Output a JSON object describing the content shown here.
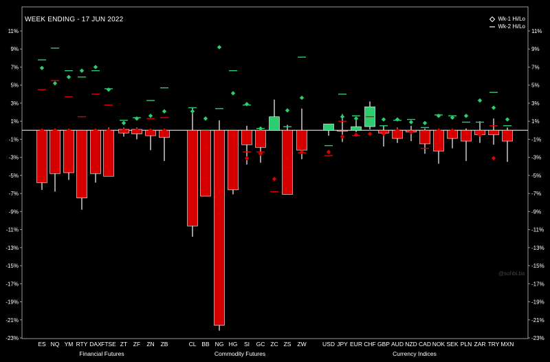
{
  "chart_data": {
    "type": "bar",
    "title": "WEEK ENDING - 17 JUN 2022",
    "ylim": [
      -23,
      11
    ],
    "yticks": [
      11,
      9,
      7,
      5,
      3,
      1,
      -1,
      -3,
      -5,
      -7,
      -9,
      -11,
      -13,
      -15,
      -17,
      -19,
      -21,
      -23
    ],
    "ytick_labels": [
      "11%",
      "9%",
      "7%",
      "5%",
      "3%",
      "1%",
      "-1%",
      "-3%",
      "-5%",
      "-7%",
      "-9%",
      "-11%",
      "-13%",
      "-15%",
      "-17%",
      "-19%",
      "-21%",
      "-23%"
    ],
    "grid": false,
    "legend_position": "top-right",
    "legend": [
      {
        "label": "Wk-1 Hi/Lo",
        "marker": "diamond"
      },
      {
        "label": "Wk-2 Hi/Lo",
        "marker": "dash"
      }
    ],
    "colors": {
      "down": "#d40000",
      "up": "#2ecc71",
      "wick": "#ffffff",
      "wk1_high": "#2ecc71",
      "wk1_low": "#e00000",
      "wk2_high": "#2ecc71",
      "wk2_low": "#e00000",
      "zero_line": "#ffffff"
    },
    "groups": [
      {
        "name": "Financial Futures",
        "categories": [
          "ES",
          "NQ",
          "YM",
          "RTY",
          "DAX",
          "FTSE",
          "ZT",
          "ZF",
          "ZN",
          "ZB"
        ]
      },
      {
        "name": "Commodity Futures",
        "categories": [
          "CL",
          "BB",
          "NG",
          "HG",
          "SI",
          "GC",
          "ZC",
          "ZS",
          "ZW"
        ]
      },
      {
        "name": "Currency Indices",
        "categories": [
          "USD",
          "JPY",
          "EUR",
          "CHF",
          "GBP",
          "AUD",
          "NZD",
          "CAD",
          "NOK",
          "SEK",
          "PLN",
          "ZAR",
          "TRY",
          "MXN"
        ]
      }
    ],
    "series": [
      {
        "name": "ES",
        "open": 0,
        "close": -5.8,
        "high": 0,
        "low": -6.6,
        "wk1_hi": 6.9,
        "wk1_lo": 0,
        "wk2_hi": 7.8,
        "wk2_lo": 4.5
      },
      {
        "name": "NQ",
        "open": 0,
        "close": -4.8,
        "high": 0,
        "low": -6.8,
        "wk1_hi": 5.2,
        "wk1_lo": 0,
        "wk2_hi": 9.1,
        "wk2_lo": 5.5
      },
      {
        "name": "YM",
        "open": 0,
        "close": -4.7,
        "high": 0,
        "low": -5.5,
        "wk1_hi": 5.9,
        "wk1_lo": 0,
        "wk2_hi": 6.6,
        "wk2_lo": 3.7
      },
      {
        "name": "RTY",
        "open": 0,
        "close": -7.5,
        "high": 0,
        "low": -8.8,
        "wk1_hi": 6.6,
        "wk1_lo": -0.5,
        "wk2_hi": 5.9,
        "wk2_lo": 1.5
      },
      {
        "name": "DAX",
        "open": 0,
        "close": -4.8,
        "high": 0,
        "low": -5.8,
        "wk1_hi": 7.0,
        "wk1_lo": 0,
        "wk2_hi": 6.6,
        "wk2_lo": 4.0
      },
      {
        "name": "FTSE",
        "open": 0,
        "close": -5.1,
        "high": 0.3,
        "low": -5.1,
        "wk1_hi": 4.5,
        "wk1_lo": 0,
        "wk2_hi": 4.6,
        "wk2_lo": 2.8
      },
      {
        "name": "ZT",
        "open": 0.1,
        "close": -0.3,
        "high": 0.3,
        "low": -0.7,
        "wk1_hi": 0.8,
        "wk1_lo": 0,
        "wk2_hi": 1.1,
        "wk2_lo": 0
      },
      {
        "name": "ZF",
        "open": 0.1,
        "close": -0.4,
        "high": 0.3,
        "low": -1.0,
        "wk1_hi": 1.3,
        "wk1_lo": 0,
        "wk2_hi": 1.4,
        "wk2_lo": 0
      },
      {
        "name": "ZN",
        "open": 0,
        "close": -0.6,
        "high": 0,
        "low": -2.2,
        "wk1_hi": 1.6,
        "wk1_lo": 0,
        "wk2_hi": 3.3,
        "wk2_lo": 1.3
      },
      {
        "name": "ZB",
        "open": 0,
        "close": -0.8,
        "high": 0,
        "low": -3.4,
        "wk1_hi": 2.1,
        "wk1_lo": 0,
        "wk2_hi": 4.7,
        "wk2_lo": 1.4
      },
      {
        "name": "CL",
        "open": 0,
        "close": -10.6,
        "high": 2.5,
        "low": -11.8,
        "wk1_hi": 2.1,
        "wk1_lo": -2.9,
        "wk2_hi": 2.5,
        "wk2_lo": -7.9
      },
      {
        "name": "BB",
        "open": 0,
        "close": -7.3,
        "high": 0,
        "low": -7.3,
        "wk1_hi": 1.3,
        "wk1_lo": -1.9,
        "wk2_hi": 0,
        "wk2_lo": -5.3
      },
      {
        "name": "NG",
        "open": 0,
        "close": -21.6,
        "high": 1.1,
        "low": -22.2,
        "wk1_hi": 9.2,
        "wk1_lo": -9.3,
        "wk2_hi": 2.4,
        "wk2_lo": -8.2
      },
      {
        "name": "HG",
        "open": 0,
        "close": -6.6,
        "high": 0,
        "low": -7.1,
        "wk1_hi": 4.1,
        "wk1_lo": -0.6,
        "wk2_hi": 6.6,
        "wk2_lo": -0.5
      },
      {
        "name": "SI",
        "open": 0,
        "close": -1.6,
        "high": 0.5,
        "low": -3.8,
        "wk1_hi": 2.9,
        "wk1_lo": -3.1,
        "wk2_hi": 2.8,
        "wk2_lo": -2.4
      },
      {
        "name": "GC",
        "open": 0,
        "close": -1.9,
        "high": 0.2,
        "low": -3.6,
        "wk1_hi": 0.2,
        "wk1_lo": -2.6,
        "wk2_hi": 0.2,
        "wk2_lo": -2.4
      },
      {
        "name": "ZC",
        "open": 0,
        "close": 1.5,
        "high": 3.4,
        "low": 0,
        "wk1_hi": 1.0,
        "wk1_lo": -5.4,
        "wk2_hi": 0.7,
        "wk2_lo": -6.8
      },
      {
        "name": "ZS",
        "open": 0,
        "close": -7.1,
        "high": 0.6,
        "low": -7.1,
        "wk1_hi": 2.2,
        "wk1_lo": -3.2,
        "wk2_hi": 0.4,
        "wk2_lo": -4.1
      },
      {
        "name": "ZW",
        "open": 0,
        "close": -2.2,
        "high": 2.4,
        "low": -3.2,
        "wk1_hi": 3.6,
        "wk1_lo": -2.4,
        "wk2_hi": 8.1,
        "wk2_lo": -2.5
      },
      {
        "name": "USD",
        "open": 0,
        "close": 0.7,
        "high": 0.7,
        "low": -0.6,
        "wk1_hi": 0.3,
        "wk1_lo": -2.4,
        "wk2_hi": -1.7,
        "wk2_lo": -2.8
      },
      {
        "name": "JPY",
        "open": 0,
        "close": -0.1,
        "high": 1.8,
        "low": -1.3,
        "wk1_hi": 1.5,
        "wk1_lo": -0.7,
        "wk2_hi": 4.0,
        "wk2_lo": 1.0
      },
      {
        "name": "EUR",
        "open": 0,
        "close": 0.4,
        "high": 1.4,
        "low": -0.2,
        "wk1_hi": 1.3,
        "wk1_lo": -0.5,
        "wk2_hi": 1.6,
        "wk2_lo": -0.6
      },
      {
        "name": "CHF",
        "open": 0.4,
        "close": 2.6,
        "high": 3.2,
        "low": 0.1,
        "wk1_hi": 1.0,
        "wk1_lo": -0.4,
        "wk2_hi": 2.4,
        "wk2_lo": 1.5
      },
      {
        "name": "GBP",
        "open": 0,
        "close": -0.3,
        "high": 0.5,
        "low": -1.8,
        "wk1_hi": 1.2,
        "wk1_lo": -0.4,
        "wk2_hi": 0.5,
        "wk2_lo": -0.2
      },
      {
        "name": "AUD",
        "open": 0,
        "close": -0.9,
        "high": 0.3,
        "low": -1.4,
        "wk1_hi": 1.2,
        "wk1_lo": 0,
        "wk2_hi": 1.1,
        "wk2_lo": -0.8
      },
      {
        "name": "NZD",
        "open": 0,
        "close": -0.2,
        "high": 0.5,
        "low": -1.2,
        "wk1_hi": 0.9,
        "wk1_lo": -0.2,
        "wk2_hi": 1.2,
        "wk2_lo": -0.1
      },
      {
        "name": "CAD",
        "open": 0,
        "close": -1.5,
        "high": 0.2,
        "low": -2.6,
        "wk1_hi": 0.8,
        "wk1_lo": -0.2,
        "wk2_hi": 0.3,
        "wk2_lo": -2.0
      },
      {
        "name": "NOK",
        "open": 0,
        "close": -2.3,
        "high": 0,
        "low": -3.7,
        "wk1_hi": 1.6,
        "wk1_lo": 0,
        "wk2_hi": 1.7,
        "wk2_lo": -0.3
      },
      {
        "name": "SEK",
        "open": 0,
        "close": -0.9,
        "high": 0.1,
        "low": -2.0,
        "wk1_hi": 1.4,
        "wk1_lo": 0,
        "wk2_hi": 1.6,
        "wk2_lo": -0.6
      },
      {
        "name": "PLN",
        "open": 0,
        "close": -1.2,
        "high": 0.2,
        "low": -3.4,
        "wk1_hi": 1.6,
        "wk1_lo": -0.3,
        "wk2_hi": 0.9,
        "wk2_lo": -0.1
      },
      {
        "name": "ZAR",
        "open": 0,
        "close": -0.5,
        "high": 1.0,
        "low": -1.4,
        "wk1_hi": 3.3,
        "wk1_lo": -0.5,
        "wk2_hi": 0.9,
        "wk2_lo": -0.4
      },
      {
        "name": "TRY",
        "open": 0,
        "close": -0.5,
        "high": 1.3,
        "low": -1.6,
        "wk1_hi": 2.5,
        "wk1_lo": -3.1,
        "wk2_hi": 4.2,
        "wk2_lo": 0.5
      },
      {
        "name": "MXN",
        "open": 0,
        "close": -1.2,
        "high": 0.3,
        "low": -3.5,
        "wk1_hi": 1.2,
        "wk1_lo": -0.3,
        "wk2_hi": 0.5,
        "wk2_lo": -0.6
      }
    ],
    "watermark": "@sohbi.ba"
  }
}
